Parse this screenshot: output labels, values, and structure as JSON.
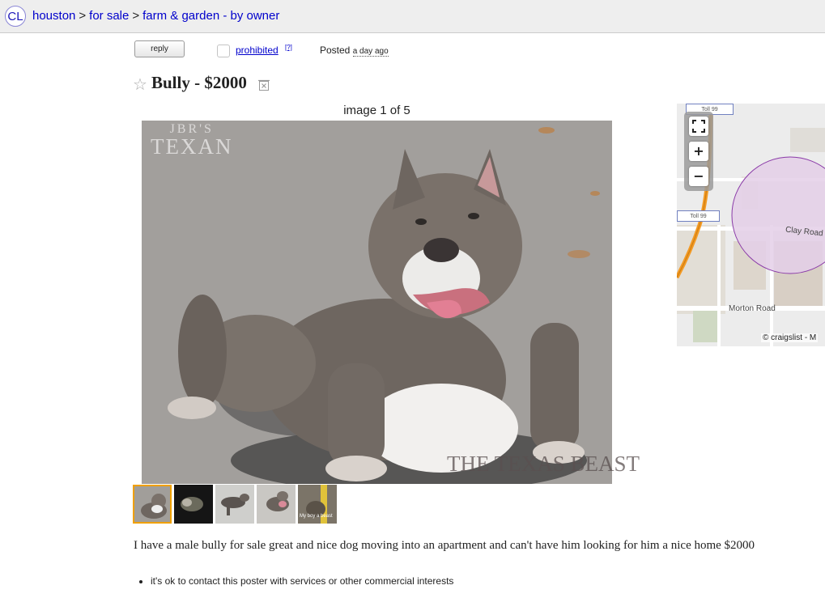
{
  "header": {
    "logo": "CL",
    "breadcrumbs": [
      "houston",
      "for sale",
      "farm & garden - by owner"
    ],
    "separator": ">"
  },
  "actions": {
    "reply_label": "reply",
    "prohibited_label": "prohibited",
    "help_label": "[?]",
    "posted_label": "Posted",
    "posted_time": "a day ago"
  },
  "posting": {
    "title": "Bully - $2000",
    "star_icon": "star-icon",
    "hide_icon": "hide-icon",
    "image_counter": "image 1 of 5",
    "photo_watermark_top_1": "JBR'S",
    "photo_watermark_top_2": "TEXAN",
    "photo_watermark_bottom": "THE TEXAS BEAST",
    "thumbnail_count": 5,
    "selected_thumbnail": 1,
    "thumbnail_caption": "My boy a beast",
    "body": "I have a male bully for sale great and nice dog moving into an apartment and can't have him looking for him a nice home $2000",
    "notices": [
      "it's ok to contact this poster with services or other commercial interests"
    ]
  },
  "map": {
    "labels": {
      "toll_top": "Toll 99",
      "toll_mid": "Toll 99",
      "clay_road": "Clay Road",
      "morton_road": "Morton Road"
    },
    "credit": "© craigslist - M",
    "controls": {
      "fullscreen": "fullscreen-icon",
      "zoom_in": "+",
      "zoom_out": "−"
    }
  },
  "colors": {
    "link": "#0000cc",
    "header_bg": "#eeeeee",
    "selected_thumb_border": "#f0a000",
    "map_circle": "#e4cfe8",
    "map_circle_stroke": "#8a3aa8",
    "toll_road": "#f39a24"
  }
}
